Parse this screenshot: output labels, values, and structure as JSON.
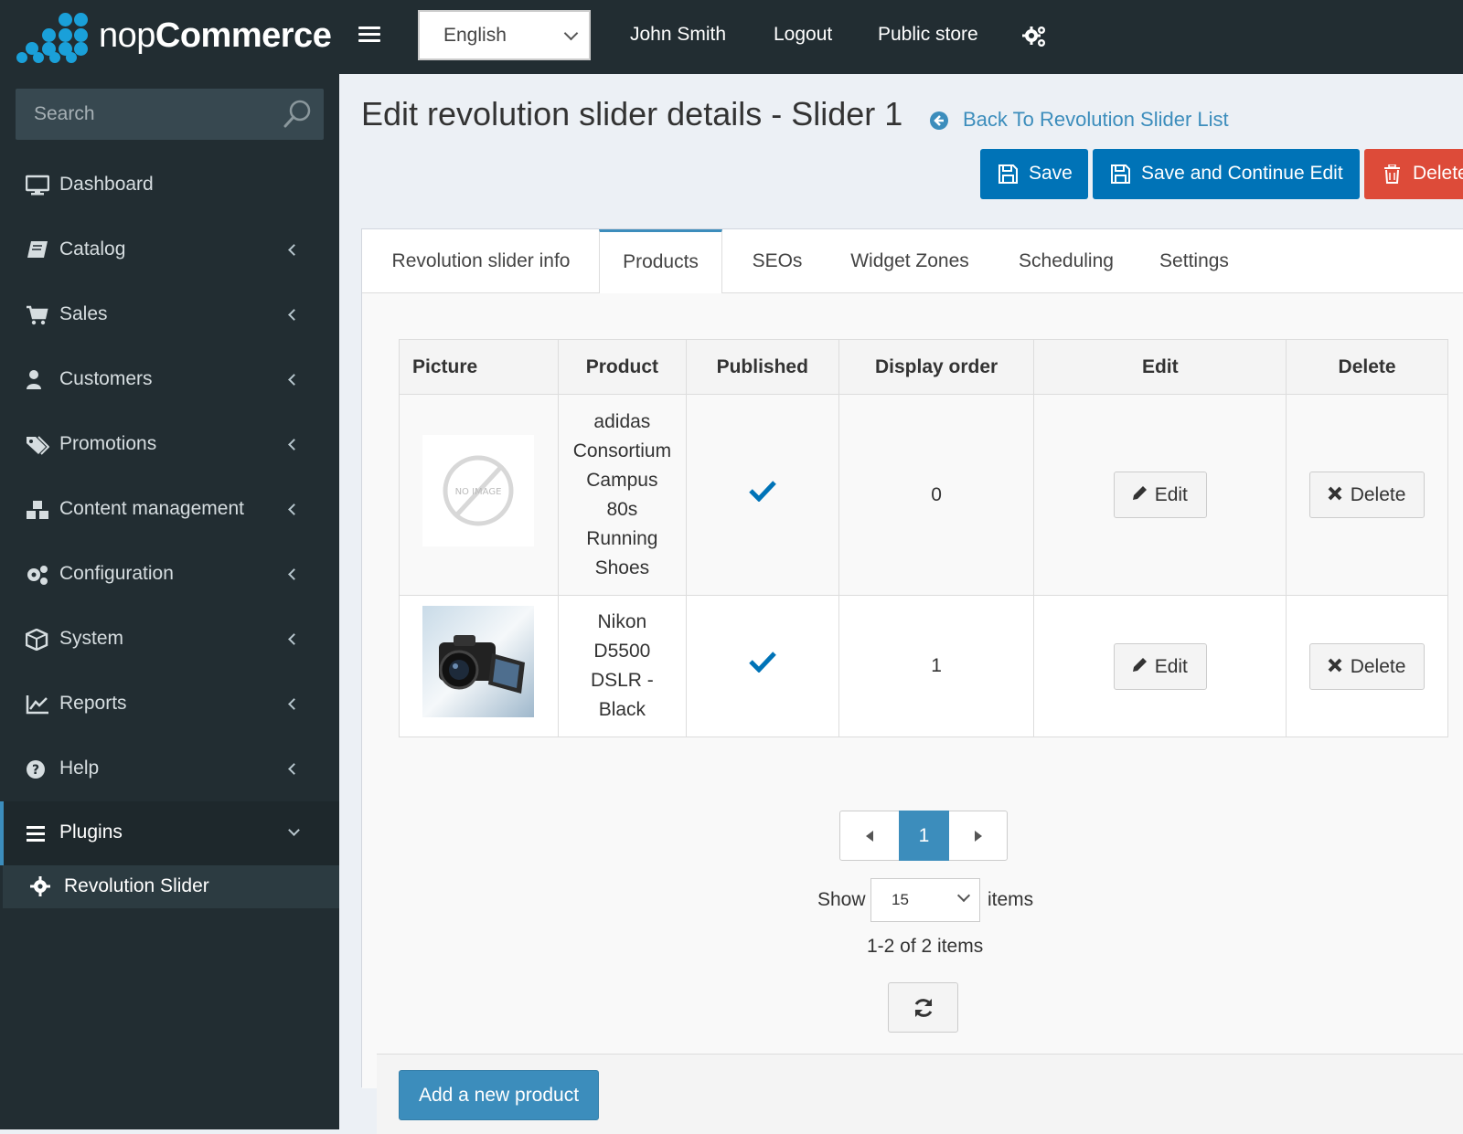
{
  "brand": {
    "name_light": "nop",
    "name_bold": "Commerce",
    "accent": "#1aa0d9"
  },
  "header": {
    "language": "English",
    "user": "John Smith",
    "logout": "Logout",
    "public_store": "Public store",
    "settings_icon": "gears-icon"
  },
  "sidebar": {
    "search_placeholder": "Search",
    "items": [
      {
        "label": "Dashboard",
        "icon": "monitor-icon"
      },
      {
        "label": "Catalog",
        "icon": "book-icon"
      },
      {
        "label": "Sales",
        "icon": "cart-icon"
      },
      {
        "label": "Customers",
        "icon": "user-icon"
      },
      {
        "label": "Promotions",
        "icon": "tags-icon"
      },
      {
        "label": "Content management",
        "icon": "cubes-icon"
      },
      {
        "label": "Configuration",
        "icon": "gears-icon"
      },
      {
        "label": "System",
        "icon": "cube-icon"
      },
      {
        "label": "Reports",
        "icon": "chart-icon"
      },
      {
        "label": "Help",
        "icon": "question-icon"
      },
      {
        "label": "Plugins",
        "icon": "bars-icon"
      }
    ],
    "sub_item": {
      "label": "Revolution Slider",
      "icon": "gear-icon"
    }
  },
  "page": {
    "title": "Edit revolution slider details - Slider 1",
    "back_link": "Back To Revolution Slider List",
    "save": "Save",
    "save_continue": "Save and Continue Edit",
    "delete": "Delete",
    "colors": {
      "primary": "#0073b7",
      "danger": "#dd4b39"
    }
  },
  "tabs": [
    {
      "label": "Revolution slider info"
    },
    {
      "label": "Products"
    },
    {
      "label": "SEOs"
    },
    {
      "label": "Widget Zones"
    },
    {
      "label": "Scheduling"
    },
    {
      "label": "Settings"
    }
  ],
  "grid": {
    "columns": [
      "Picture",
      "Product",
      "Published",
      "Display order",
      "Edit",
      "Delete"
    ],
    "rows": [
      {
        "picture": "no-image",
        "product": [
          "adidas",
          "Consortium",
          "Campus",
          "80s",
          "Running",
          "Shoes"
        ],
        "published": true,
        "display_order": "0",
        "edit": "Edit",
        "delete": "Delete"
      },
      {
        "picture": "camera",
        "product": [
          "Nikon",
          "D5500",
          "DSLR -",
          "Black"
        ],
        "published": true,
        "display_order": "1",
        "edit": "Edit",
        "delete": "Delete"
      }
    ],
    "no_image_text": "NO IMAGE"
  },
  "pager": {
    "current": "1",
    "show": "Show",
    "page_size": "15",
    "items": "items",
    "range": "1-2 of 2 items"
  },
  "footer": {
    "add": "Add a new product"
  }
}
